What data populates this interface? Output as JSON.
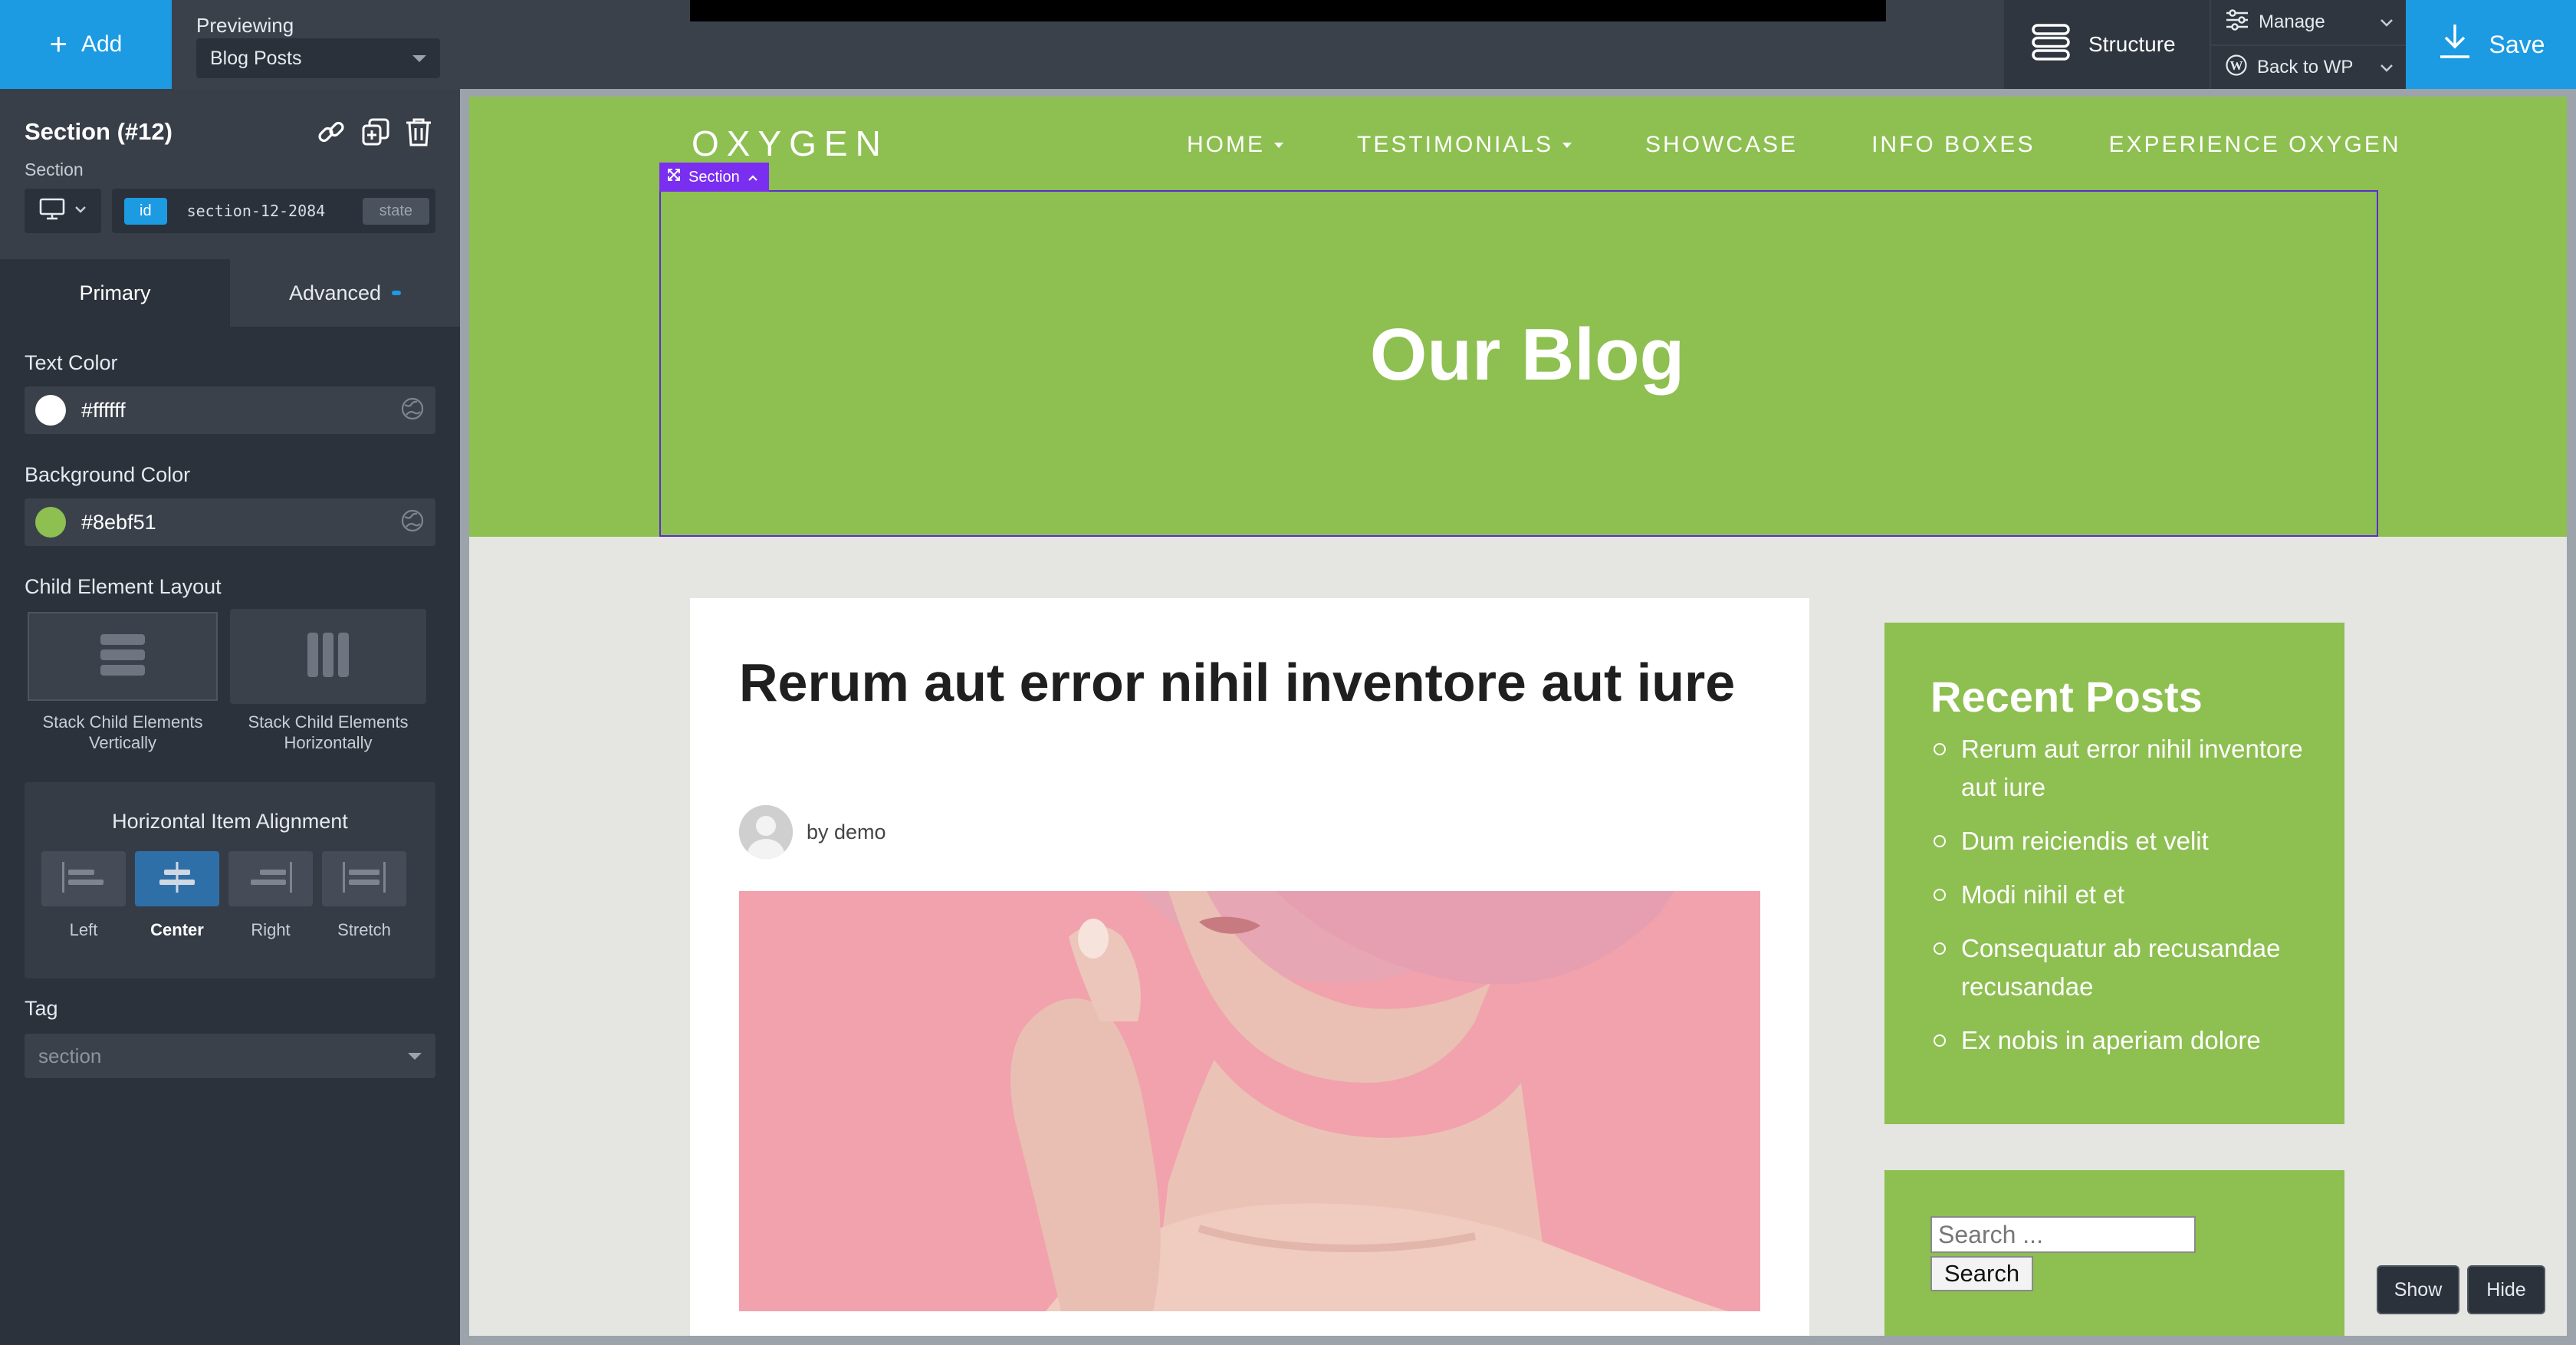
{
  "topbar": {
    "add_label": "Add",
    "previewing_label": "Previewing",
    "previewing_value": "Blog Posts",
    "structure_label": "Structure",
    "manage_label": "Manage",
    "back_label": "Back to WP",
    "save_label": "Save"
  },
  "panel": {
    "title": "Section (#12)",
    "subtitle": "Section",
    "id_badge": "id",
    "id_value": "section-12-2084",
    "state_badge": "state",
    "tabs": {
      "primary": "Primary",
      "advanced": "Advanced"
    },
    "text_color": {
      "label": "Text Color",
      "value": "#ffffff"
    },
    "background_color": {
      "label": "Background Color",
      "value": "#8ebf51"
    },
    "child_layout": {
      "label": "Child Element Layout",
      "vertical": "Stack Child Elements Vertically",
      "horizontal": "Stack Child Elements Horizontally",
      "selected": "vertical"
    },
    "alignment": {
      "title": "Horizontal Item Alignment",
      "options": [
        "Left",
        "Center",
        "Right",
        "Stretch"
      ],
      "selected": "Center"
    },
    "tag": {
      "label": "Tag",
      "placeholder": "section"
    }
  },
  "site": {
    "logo": "OXYGEN",
    "nav": [
      {
        "label": "HOME",
        "dropdown": true
      },
      {
        "label": "TESTIMONIALS",
        "dropdown": true
      },
      {
        "label": "SHOWCASE",
        "dropdown": false
      },
      {
        "label": "INFO BOXES",
        "dropdown": false
      },
      {
        "label": "EXPERIENCE OXYGEN",
        "dropdown": false
      }
    ],
    "selection_tag": "Section",
    "hero_title": "Our Blog",
    "post": {
      "title": "Rerum aut error nihil inventore aut iure",
      "author": "by demo"
    },
    "recent_posts": {
      "title": "Recent Posts",
      "items": [
        "Rerum aut error nihil inventore aut iure",
        "Dum reiciendis et velit",
        "Modi nihil et et",
        "Consequatur ab recusandae recusandae",
        "Ex nobis in aperiam dolore"
      ]
    },
    "search": {
      "placeholder": "Search ...",
      "button": "Search"
    }
  },
  "overlay": {
    "show_label": "Show",
    "hide_label": "Hide"
  },
  "colors": {
    "accent": "#1c9be2",
    "site_green": "#8ebf51",
    "selection_purple": "#7a2ef0",
    "panel_bg": "#2b323c"
  },
  "icons": [
    "plus-icon",
    "structure-icon",
    "manage-icon",
    "wordpress-icon",
    "download-icon",
    "link-icon",
    "duplicate-icon",
    "trash-icon",
    "desktop-icon",
    "globe-icon",
    "stack-vertical-icon",
    "stack-horizontal-icon",
    "align-left-icon",
    "align-center-icon",
    "align-right-icon",
    "align-stretch-icon",
    "expand-icon",
    "chevron-up-icon"
  ]
}
